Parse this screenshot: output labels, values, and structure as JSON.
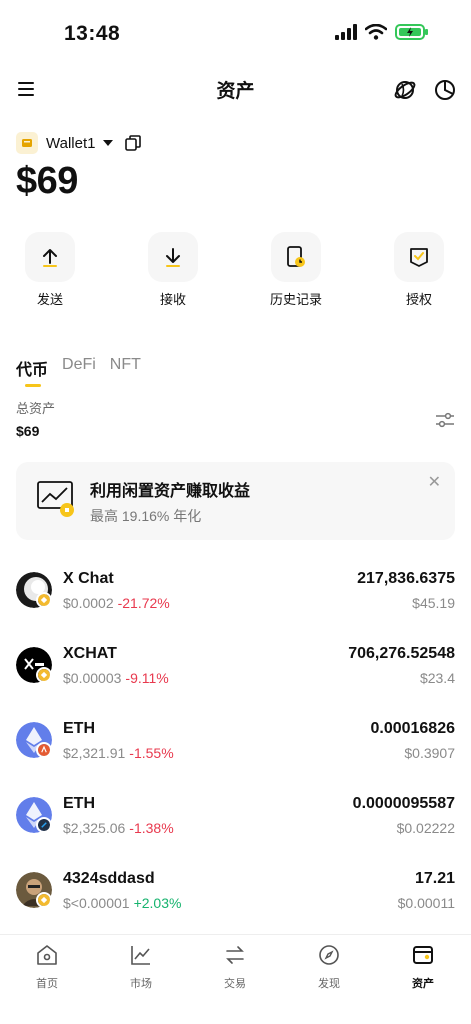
{
  "status": {
    "time": "13:48"
  },
  "header": {
    "title": "资产"
  },
  "wallet": {
    "name": "Wallet1",
    "balance": "$69"
  },
  "actions": [
    {
      "label": "发送",
      "icon": "send-icon"
    },
    {
      "label": "接收",
      "icon": "receive-icon"
    },
    {
      "label": "历史记录",
      "icon": "history-icon"
    },
    {
      "label": "授权",
      "icon": "authorize-icon"
    }
  ],
  "tabs": [
    {
      "label": "代币",
      "active": true
    },
    {
      "label": "DeFi",
      "active": false
    },
    {
      "label": "NFT",
      "active": false
    }
  ],
  "summary": {
    "label": "总资产",
    "value": "$69"
  },
  "promo": {
    "title": "利用闲置资产赚取收益",
    "subtitle": "最高 19.16% 年化"
  },
  "tokens": [
    {
      "name": "X Chat",
      "price": "$0.0002",
      "change": "-21.72%",
      "amount": "217,836.6375",
      "fiat": "$45.19"
    },
    {
      "name": "XCHAT",
      "price": "$0.00003",
      "change": "-9.11%",
      "amount": "706,276.52548",
      "fiat": "$23.4"
    },
    {
      "name": "ETH",
      "price": "$2,321.91",
      "change": "-1.55%",
      "amount": "0.00016826",
      "fiat": "$0.3907"
    },
    {
      "name": "ETH",
      "price": "$2,325.06",
      "change": "-1.38%",
      "amount": "0.0000095587",
      "fiat": "$0.02222"
    },
    {
      "name": "4324sddasd",
      "price": "$<0.00001",
      "change": "+2.03%",
      "amount": "17.21",
      "fiat": "$0.00011"
    }
  ],
  "nav": [
    {
      "label": "首页",
      "icon": "home-icon"
    },
    {
      "label": "市场",
      "icon": "market-icon"
    },
    {
      "label": "交易",
      "icon": "trade-icon"
    },
    {
      "label": "发现",
      "icon": "discover-icon"
    },
    {
      "label": "资产",
      "icon": "assets-icon",
      "active": true
    }
  ],
  "colors": {
    "accent": "#f7c51a",
    "negative": "#e8394e",
    "positive": "#16b36e",
    "battery": "#34c759"
  }
}
